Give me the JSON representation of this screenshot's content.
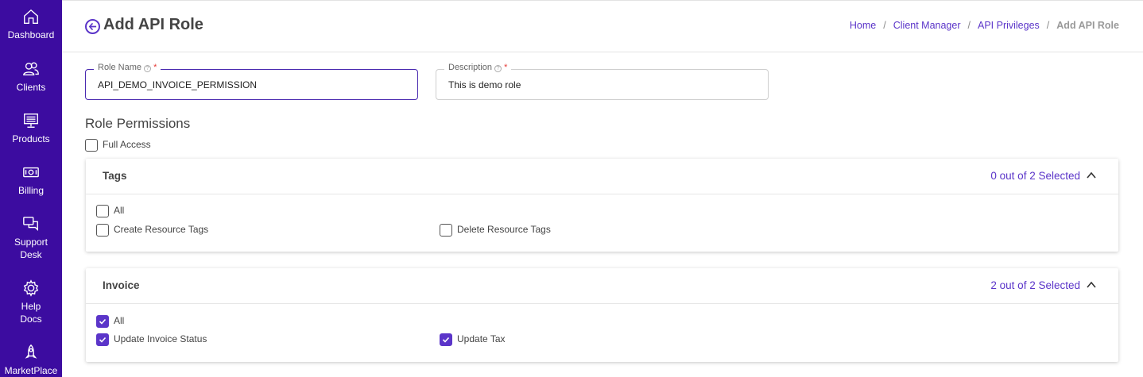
{
  "sidebar": {
    "items": [
      {
        "label": "Dashboard",
        "icon": "home-icon"
      },
      {
        "label": "Clients",
        "icon": "users-icon"
      },
      {
        "label": "Products",
        "icon": "server-icon"
      },
      {
        "label": "Billing",
        "icon": "money-icon"
      },
      {
        "label": "Support Desk",
        "label_line1": "Support",
        "label_line2": "Desk",
        "icon": "chat-icon"
      },
      {
        "label": "Help Docs",
        "label_line1": "Help",
        "label_line2": "Docs",
        "icon": "gear-icon"
      },
      {
        "label": "MarketPlace",
        "icon": "rocket-icon"
      }
    ]
  },
  "header": {
    "title": "Add API Role",
    "breadcrumb": {
      "items": [
        "Home",
        "Client Manager",
        "API Privileges"
      ],
      "current": "Add API Role",
      "separator": "/"
    }
  },
  "form": {
    "role_name": {
      "label": "Role Name",
      "required_mark": "*",
      "value": "API_DEMO_INVOICE_PERMISSION"
    },
    "description": {
      "label": "Description",
      "required_mark": "*",
      "value": "This is demo role"
    }
  },
  "permissions": {
    "title": "Role Permissions",
    "full_access": {
      "label": "Full Access",
      "checked": false
    },
    "groups": [
      {
        "title": "Tags",
        "count_text": "0 out of 2 Selected",
        "all": {
          "label": "All",
          "checked": false
        },
        "options": [
          {
            "label": "Create Resource Tags",
            "checked": false
          },
          {
            "label": "Delete Resource Tags",
            "checked": false
          }
        ]
      },
      {
        "title": "Invoice",
        "count_text": "2 out of 2 Selected",
        "all": {
          "label": "All",
          "checked": true
        },
        "options": [
          {
            "label": "Update Invoice Status",
            "checked": true
          },
          {
            "label": "Update Tax",
            "checked": true
          }
        ]
      }
    ]
  },
  "colors": {
    "sidebar_bg": "#3c0ca0",
    "accent": "#5b35c9",
    "required": "#e53935"
  }
}
